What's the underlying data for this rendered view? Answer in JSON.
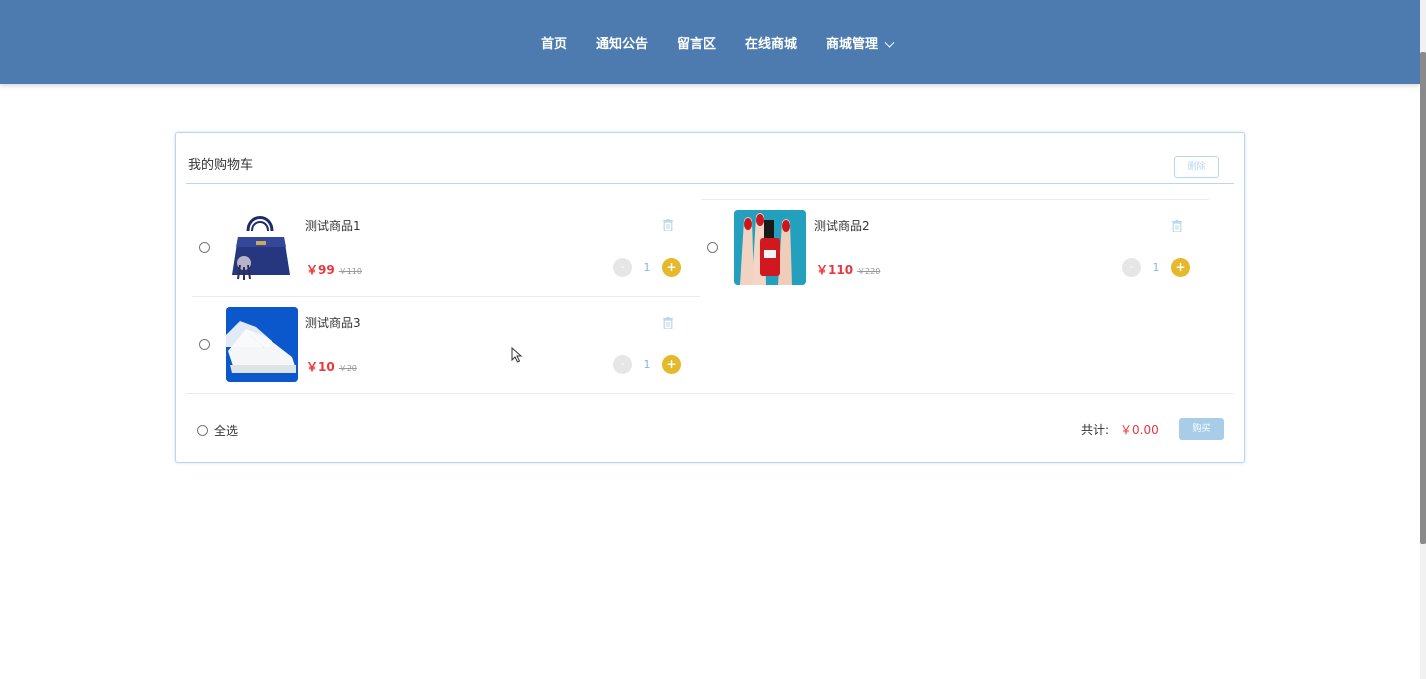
{
  "nav": {
    "items": [
      {
        "label": "首页"
      },
      {
        "label": "通知公告"
      },
      {
        "label": "留言区"
      },
      {
        "label": "在线商城"
      },
      {
        "label": "商城管理"
      }
    ]
  },
  "cart": {
    "title": "我的购物车",
    "delete_label": "删除",
    "items": [
      {
        "name": "测试商品1",
        "price": "￥99",
        "old_price": "￥110",
        "quantity": "1",
        "minus": "-",
        "plus": "+",
        "image": "handbag-image"
      },
      {
        "name": "测试商品2",
        "price": "￥110",
        "old_price": "￥220",
        "quantity": "1",
        "minus": "-",
        "plus": "+",
        "image": "nail-polish-image"
      },
      {
        "name": "测试商品3",
        "price": "￥10",
        "old_price": "￥20",
        "quantity": "1",
        "minus": "-",
        "plus": "+",
        "image": "sneaker-image"
      }
    ],
    "select_all_label": "全选",
    "total_label": "共计:",
    "total_value": "￥0.00",
    "buy_label": "购买"
  },
  "colors": {
    "header": "#4d7bb0",
    "accent_border": "#b8d7ee",
    "price": "#e8383d",
    "plus": "#e5b92b",
    "buy": "#a9cde8"
  }
}
